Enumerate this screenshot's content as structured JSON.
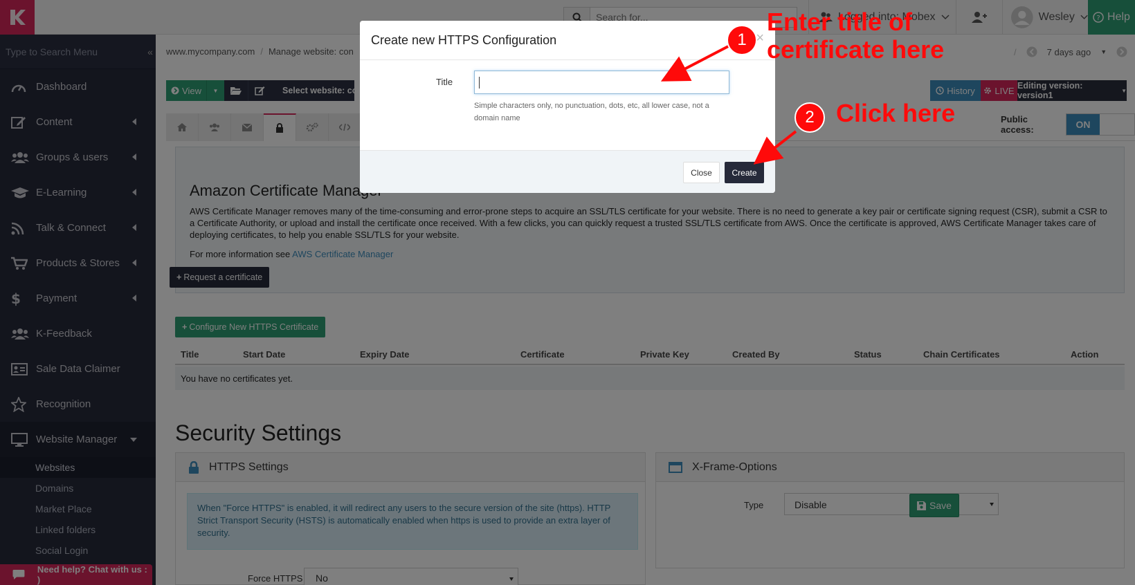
{
  "topbar": {
    "search_placeholder": "Search for...",
    "logged_into": "Logged into: Mobex",
    "user_name": "Wesley",
    "help_label": "Help"
  },
  "sidebar": {
    "search_placeholder": "Type to Search Menu",
    "items": [
      {
        "label": "Dashboard",
        "icon": "dashboard-icon"
      },
      {
        "label": "Content",
        "icon": "edit-icon"
      },
      {
        "label": "Groups & users",
        "icon": "users-icon"
      },
      {
        "label": "E-Learning",
        "icon": "graduation-cap-icon"
      },
      {
        "label": "Talk & Connect",
        "icon": "rss-icon"
      },
      {
        "label": "Products & Stores",
        "icon": "cart-icon"
      },
      {
        "label": "Payment",
        "icon": "dollar-icon"
      },
      {
        "label": "K-Feedback",
        "icon": "users-icon"
      },
      {
        "label": "Sale Data Claimer",
        "icon": "id-card-icon"
      },
      {
        "label": "Recognition",
        "icon": "star-icon"
      },
      {
        "label": "Website Manager",
        "icon": "monitor-icon"
      }
    ],
    "subitems": [
      "Websites",
      "Domains",
      "Market Place",
      "Linked folders",
      "Social Login"
    ]
  },
  "breadcrumb": {
    "root": "www.mycompany.com",
    "current": "Manage website: con",
    "time_ago": "7 days ago"
  },
  "toolbar": {
    "view_label": "View",
    "select_website": "Select website: cons",
    "history_label": "History",
    "live_label": "LIVE",
    "editing_version": "Editing version: version1"
  },
  "public_access": {
    "label": "Public access:",
    "state": "ON"
  },
  "acm": {
    "title": "Amazon Certificate Manager",
    "description": "AWS Certificate Manager removes many of the time-consuming and error-prone steps to acquire an SSL/TLS certificate for your website. There is no need to generate a key pair or certificate signing request (CSR), submit a CSR to a Certificate Authority, or upload and install the certificate once received. With a few clicks, you can quickly request a trusted SSL/TLS certificate from AWS. Once the certificate is approved, AWS Certificate Manager takes care of deploying certificates, to help you enable SSL/TLS for your website.",
    "more_info_prefix": "For more information see",
    "more_info_link": "AWS Certificate Manager",
    "request_button": "Request a certificate"
  },
  "certificates": {
    "configure_button": "Configure New HTTPS Certificate",
    "columns": [
      "Title",
      "Start Date",
      "Expiry Date",
      "Certificate",
      "Private Key",
      "Created By",
      "Status",
      "Chain Certificates",
      "Action"
    ],
    "empty_text": "You have no certificates yet."
  },
  "security": {
    "title": "Security Settings",
    "https_panel_title": "HTTPS Settings",
    "https_info": "When \"Force HTTPS\" is enabled, it will redirect any users to the secure version of the site (https). HTTP Strict Transport Security (HSTS) is automatically enabled when https is used to provide an extra layer of security.",
    "force_https_label": "Force HTTPS",
    "force_https_value": "No",
    "xframe_panel_title": "X-Frame-Options",
    "type_label": "Type",
    "type_value": "Disable",
    "save_label": "Save"
  },
  "chat": {
    "label": "Need help? Chat with us : )"
  },
  "modal": {
    "title": "Create new HTTPS Configuration",
    "close_x": "×",
    "title_label": "Title",
    "title_value": "",
    "help_text": "Simple characters only, no punctuation, dots, etc, all lower case, not a domain name",
    "close_button": "Close",
    "create_button": "Create"
  },
  "annotations": {
    "step1_number": "1",
    "step1_text_line1": "Enter title of",
    "step1_text_line2": "certificate here",
    "step2_number": "2",
    "step2_text": "Click here",
    "color": "#ff0a0a"
  },
  "colors": {
    "brand_pink": "#d6265b",
    "green": "#2e9e74",
    "sidebar_bg": "#262a3a",
    "blue": "#3c8dbc"
  }
}
